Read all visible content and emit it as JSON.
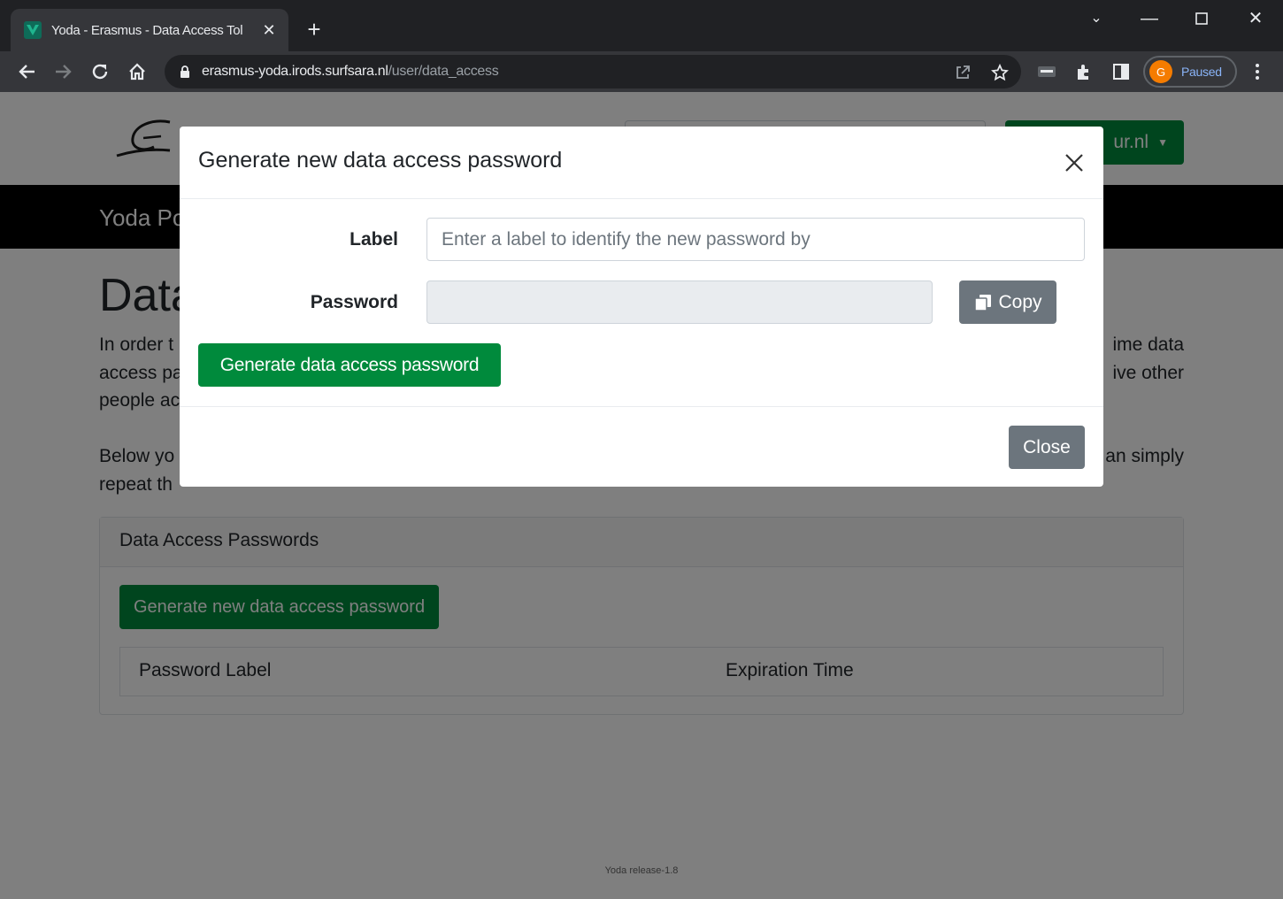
{
  "browser": {
    "tab_title": "Yoda - Erasmus - Data Access Tol",
    "url_host": "erasmus-yoda.irods.surfsara.nl",
    "url_path": "/user/data_access",
    "profile_initial": "G",
    "profile_status": "Paused"
  },
  "page": {
    "user_button": "ur.nl",
    "portal_title": "Yoda Po",
    "heading": "Data",
    "para1_left_lines": [
      "In order t",
      "access pa",
      "people ac"
    ],
    "para1_right_lines": [
      "ime data",
      "ive other"
    ],
    "para2_left_lines": [
      "Below yo",
      "repeat th"
    ],
    "para2_right_lines": [
      "an simply"
    ],
    "card_title": "Data Access Passwords",
    "generate_new_button": "Generate new data access password",
    "col_label": "Password Label",
    "col_expiration": "Expiration Time",
    "footer": "Yoda release-1.8"
  },
  "modal": {
    "title": "Generate new data access password",
    "label_field_label": "Label",
    "label_placeholder": "Enter a label to identify the new password by",
    "password_field_label": "Password",
    "copy_button": "Copy",
    "generate_button": "Generate data access password",
    "close_button": "Close"
  },
  "colors": {
    "primary_green": "#008a3c",
    "secondary_gray": "#6c757d",
    "backdrop": "rgba(0,0,0,0.5)"
  }
}
